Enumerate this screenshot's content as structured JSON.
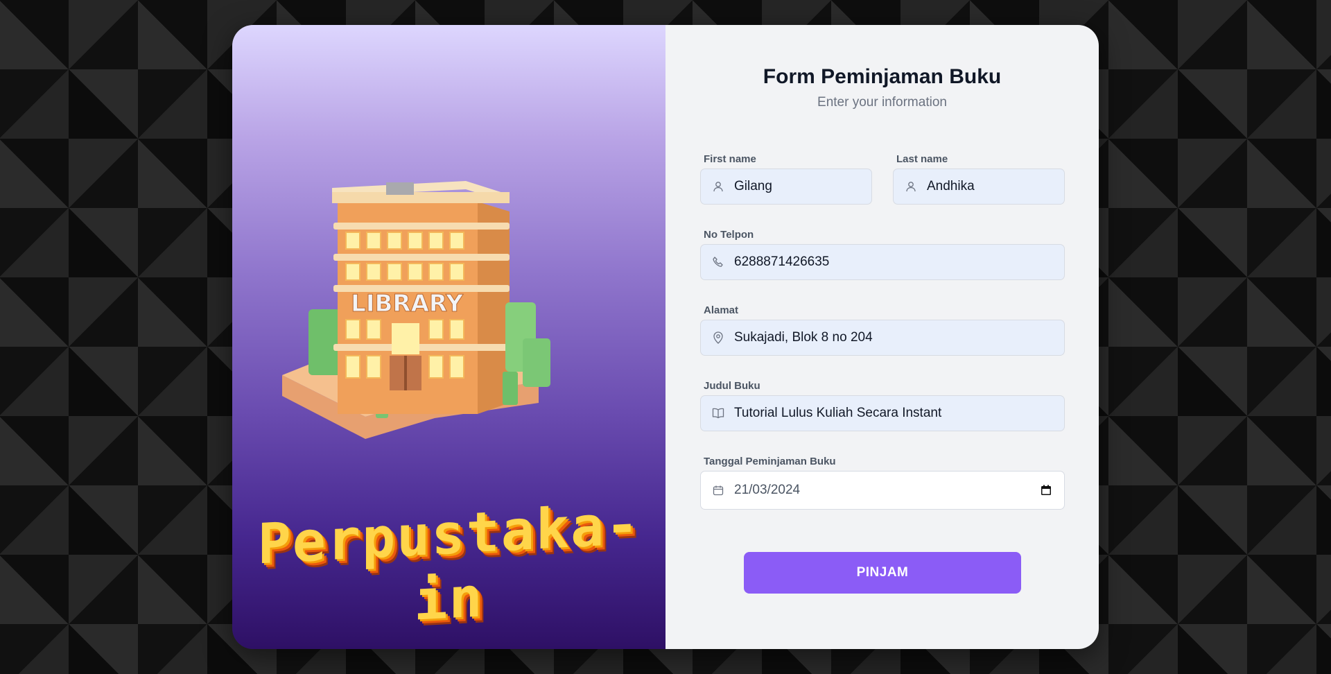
{
  "brand": {
    "logo_text": "Perpustaka-in",
    "building_sign": "LIBRARY"
  },
  "form": {
    "title": "Form Peminjaman Buku",
    "subtitle": "Enter your information",
    "first_name": {
      "label": "First name",
      "value": "Gilang"
    },
    "last_name": {
      "label": "Last name",
      "value": "Andhika"
    },
    "phone": {
      "label": "No Telpon",
      "value": "6288871426635"
    },
    "address": {
      "label": "Alamat",
      "value": "Sukajadi, Blok 8 no 204"
    },
    "book_title": {
      "label": "Judul Buku",
      "value": "Tutorial Lulus Kuliah Secara Instant"
    },
    "loan_date": {
      "label": "Tanggal Peminjaman Buku",
      "value": "21/03/2024"
    },
    "submit_label": "PINJAM"
  },
  "colors": {
    "accent": "#8b5cf6",
    "panel_gradient_top": "#ddd6fe",
    "panel_gradient_bottom": "#2e1065",
    "form_bg": "#f2f3f5",
    "input_bg": "#e8effb"
  },
  "icons": {
    "first_name": "user-icon",
    "last_name": "user-icon",
    "phone": "phone-icon",
    "address": "map-pin-icon",
    "book_title": "book-icon",
    "loan_date": "calendar-icon"
  }
}
